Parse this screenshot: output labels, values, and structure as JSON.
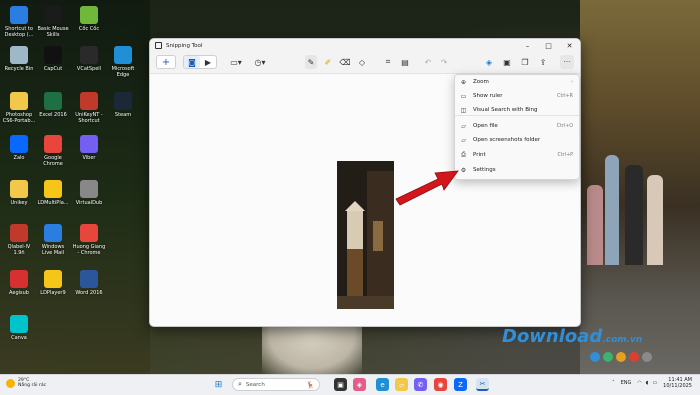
{
  "desktop_icons": [
    {
      "label": "Shortcut to Desktop (...",
      "icon": "cloud-icon",
      "color": "#2a7de1"
    },
    {
      "label": "Basic Mouse Skills",
      "icon": "mouse-icon",
      "color": "#1b1b1b"
    },
    {
      "label": "Cốc Cốc",
      "icon": "coccoc-icon",
      "color": "#6fb83a"
    },
    {
      "label": "Recycle Bin",
      "icon": "recycle-bin-icon",
      "color": "#9fb8c8"
    },
    {
      "label": "CapCut",
      "icon": "capcut-icon",
      "color": "#111111"
    },
    {
      "label": "VCatSpell",
      "icon": "vcatspell-icon",
      "color": "#2a2a2a"
    },
    {
      "label": "Microsoft Edge",
      "icon": "edge-icon",
      "color": "#1f8fd6"
    },
    {
      "label": "Photoshop CS6-Portab...",
      "icon": "folder-icon",
      "color": "#f2c84b"
    },
    {
      "label": "Excel 2016",
      "icon": "excel-icon",
      "color": "#1d7044"
    },
    {
      "label": "UniKeyNT - Shortcut",
      "icon": "unikey-icon",
      "color": "#c0392b"
    },
    {
      "label": "Steam",
      "icon": "steam-icon",
      "color": "#1b2838"
    },
    {
      "label": "Zalo",
      "icon": "zalo-icon",
      "color": "#0a68ff"
    },
    {
      "label": "Google Chrome",
      "icon": "chrome-icon",
      "color": "#e8453c"
    },
    {
      "label": "Viber",
      "icon": "viber-icon",
      "color": "#7360f2"
    },
    {
      "label": "Unikey",
      "icon": "folder-icon",
      "color": "#f2c84b"
    },
    {
      "label": "LDMultiPla...",
      "icon": "ldmultiplayer-icon",
      "color": "#f5c518"
    },
    {
      "label": "VirtualDub",
      "icon": "gear-icon",
      "color": "#888888"
    },
    {
      "label": "Qlabel-IV 1.9ñ",
      "icon": "qlabel-icon",
      "color": "#c0392b"
    },
    {
      "label": "Windows Live Mail",
      "icon": "mail-icon",
      "color": "#2a7de1"
    },
    {
      "label": "Huong Giang - Chrome",
      "icon": "chrome-icon",
      "color": "#e8453c"
    },
    {
      "label": "Aegisub",
      "icon": "aegisub-icon",
      "color": "#d63031"
    },
    {
      "label": "LDPlayer9",
      "icon": "ldplayer-icon",
      "color": "#f5c518"
    },
    {
      "label": "Word 2016",
      "icon": "word-icon",
      "color": "#2b579a"
    },
    {
      "label": "Canva",
      "icon": "canva-icon",
      "color": "#00c4cc"
    }
  ],
  "window": {
    "title": "Snipping Tool",
    "controls": {
      "minimize": "–",
      "maximize": "□",
      "close": "✕"
    }
  },
  "toolbar": {
    "new_label": "+",
    "more_label": "···"
  },
  "menu": {
    "items": [
      {
        "label": "Zoom",
        "icon": "zoom-icon",
        "shortcut": "›"
      },
      {
        "label": "Show ruler",
        "icon": "ruler-icon",
        "shortcut": "Ctrl+R"
      },
      {
        "label": "Visual Search with Bing",
        "icon": "bing-icon",
        "shortcut": ""
      },
      {
        "label": "Open file",
        "icon": "folder-icon",
        "shortcut": "Ctrl+O"
      },
      {
        "label": "Open screenshots folder",
        "icon": "folder-icon",
        "shortcut": ""
      },
      {
        "label": "Print",
        "icon": "print-icon",
        "shortcut": "Ctrl+P"
      },
      {
        "label": "Settings",
        "icon": "gear-icon",
        "shortcut": ""
      }
    ]
  },
  "watermark": {
    "brand": "Download",
    "domain": ".com.vn"
  },
  "taskbar": {
    "weather_temp": "29°C",
    "weather_desc": "Nắng rải rác",
    "search_placeholder": "Search",
    "lang": "ENG",
    "time": "11:41 AM",
    "date": "10/11/2025"
  }
}
